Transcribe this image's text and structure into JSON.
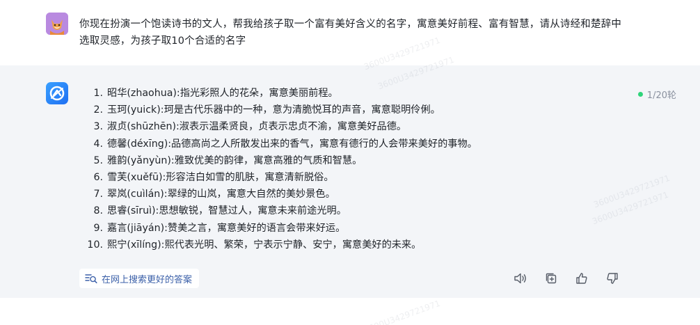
{
  "user_message": {
    "text": "你现在扮演一个饱读诗书的文人，帮我给孩子取一个富有美好含义的名字，寓意美好前程、富有智慧，请从诗经和楚辞中选取灵感，为孩子取10个合适的名字"
  },
  "assistant": {
    "round_counter": "1/20轮",
    "answers": [
      {
        "num": "1.",
        "text": "昭华(zhaohua):指光彩照人的花朵，寓意美丽前程。"
      },
      {
        "num": "2.",
        "text": "玉珂(yuick):珂是古代乐器中的一种，意为清脆悦耳的声音，寓意聪明伶俐。"
      },
      {
        "num": "3.",
        "text": "淑贞(shūzhēn):淑表示温柔贤良，贞表示忠贞不渝，寓意美好品德。"
      },
      {
        "num": "4.",
        "text": "德馨(déxīng):品德高尚之人所散发出来的香气，寓意有德行的人会带来美好的事物。"
      },
      {
        "num": "5.",
        "text": "雅韵(yǎnyùn):雅致优美的韵律，寓意高雅的气质和智慧。"
      },
      {
        "num": "6.",
        "text": "雪芙(xuěfū):形容洁白如雪的肌肤，寓意清新脱俗。"
      },
      {
        "num": "7.",
        "text": "翠岚(cuìlán):翠绿的山岚，寓意大自然的美妙景色。"
      },
      {
        "num": "8.",
        "text": "思睿(sīruì):思想敏锐，智慧过人，寓意未来前途光明。"
      },
      {
        "num": "9.",
        "text": "嘉言(jiāyán):赞美之言，寓意美好的语言会带来好运。"
      },
      {
        "num": "10.",
        "text": "熙宁(xīlíng):熙代表光明、繁荣，宁表示宁静、安宁，寓意美好的未来。"
      }
    ],
    "search_label": "在网上搜索更好的答案",
    "icons": {
      "search": "search-list-icon",
      "speaker": "speaker-icon",
      "copy": "copy-icon",
      "like": "thumbs-up-icon",
      "dislike": "thumbs-down-icon"
    }
  },
  "watermark": "3600U3429721971",
  "colors": {
    "assistant_bg": "#f3f5f8",
    "link": "#3a5fa8",
    "status_dot": "#2fd47a",
    "ai_avatar": "#1e6ff2",
    "user_avatar": "#b98ae0"
  }
}
